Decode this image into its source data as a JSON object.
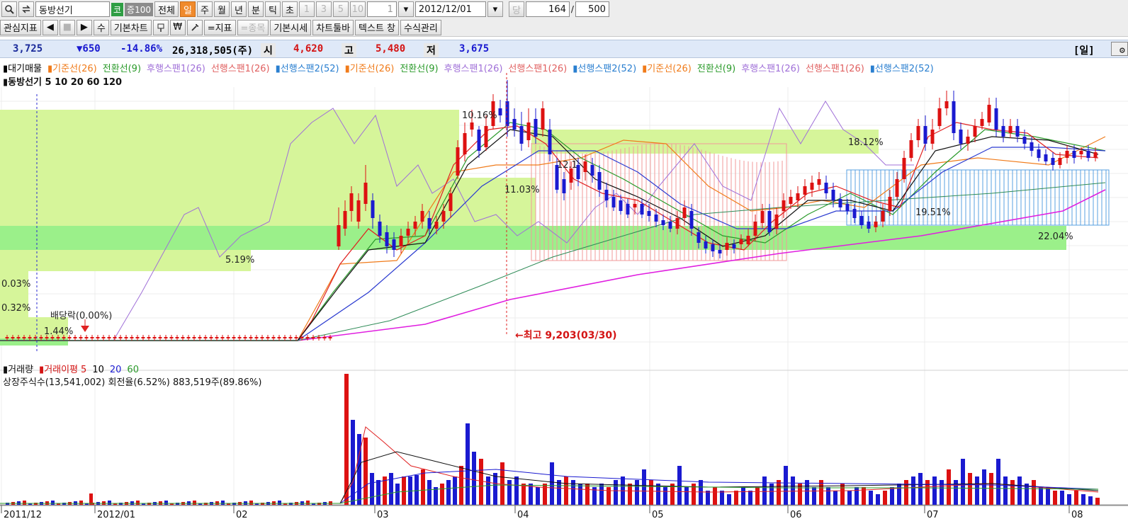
{
  "toolbar1": {
    "search_icon": "magnifier-icon",
    "refresh_icon": "swap-icon",
    "stock_name": "동방선기",
    "badge_market": "코",
    "badge_group": "증100",
    "btn_all": "전체",
    "periods": [
      "일",
      "주",
      "월",
      "년",
      "분",
      "틱",
      "초"
    ],
    "active_period": "일",
    "minute_steps": [
      "1",
      "3",
      "5",
      "10"
    ],
    "interval_value": "1",
    "date_value": "2012/12/01",
    "date_label": "당",
    "count_value": "164",
    "count_sep": "/",
    "count_total": "500"
  },
  "toolbar2": {
    "watchlist": "관심지표",
    "prev": "◀",
    "stop": "■",
    "next": "▶",
    "edit": "수",
    "basic_chart": "기본차트",
    "icon1": "shovel-icon",
    "won": "₩",
    "tool": "wrench-icon",
    "indicator": "=지표",
    "item": "=종목",
    "basic_quote": "기본시세",
    "toolbar": "차트툴바",
    "text_window": "텍스트 창",
    "formula": "수식관리"
  },
  "quote": {
    "price": "3,725",
    "change": "▼650",
    "pct": "-14.86%",
    "volume": "26,318,505(주)",
    "open_label": "시",
    "open": "4,620",
    "high_label": "고",
    "high": "5,480",
    "low_label": "저",
    "low": "3,675",
    "period_tag": "[일]"
  },
  "legend_top": {
    "items": [
      {
        "text": "▮대기매물",
        "color": "#000000"
      },
      {
        "text": "▮기준선(26)",
        "color": "#f07b1a"
      },
      {
        "text": "전환선(9)",
        "color": "#2a9a2a"
      },
      {
        "text": "후행스팬1(26)",
        "color": "#a070d8"
      },
      {
        "text": "선행스팬1(26)",
        "color": "#e06060"
      },
      {
        "text": "▮선행스팬2(52)",
        "color": "#2a7fd0"
      },
      {
        "text": "▮기준선(26)",
        "color": "#f07b1a"
      },
      {
        "text": "전환선(9)",
        "color": "#2a9a2a"
      },
      {
        "text": "후행스팬1(26)",
        "color": "#a070d8"
      },
      {
        "text": "선행스팬1(26)",
        "color": "#e06060"
      },
      {
        "text": "▮선행스팬2(52)",
        "color": "#2a7fd0"
      },
      {
        "text": "▮기준선(26)",
        "color": "#f07b1a"
      },
      {
        "text": "전환선(9)",
        "color": "#2a9a2a"
      },
      {
        "text": "후행스팬1(26)",
        "color": "#a070d8"
      },
      {
        "text": "선행스팬1(26)",
        "color": "#e06060"
      },
      {
        "text": "▮선행스팬2(52)",
        "color": "#2a7fd0"
      }
    ],
    "line2": "▮동방선기 5 10 20 60 120"
  },
  "annotations": {
    "p1": "10.16%",
    "p2": "18.12%",
    "p3": "11.03%",
    "p4": "5.19%",
    "p5": "0.03%",
    "p6": "0.32%",
    "p7": "1.44%",
    "p8": "22.04%",
    "p9": "19.51%",
    "p10": "12.1",
    "dividend": "배당락(0.00%)",
    "max_price": "←최고  9,203(03/30)"
  },
  "legend_vol": {
    "line1_label": "▮거래량",
    "line1_ma": "▮거래이평",
    "ma5": "5",
    "ma10": "10",
    "ma20": "20",
    "ma60": "60",
    "line2": "상장주식수(13,541,002) 회전율(6.52%) 883,519주(89.86%)"
  },
  "xaxis": {
    "labels": [
      "2011/12",
      "2012/01",
      "02",
      "03",
      "04",
      "05",
      "06",
      "07",
      "08"
    ]
  },
  "colors": {
    "up": "#dd1111",
    "down": "#1a1ad0",
    "zone": "#d6f59a",
    "zone_strong": "#9bf08a",
    "ma120": "#e01ee0",
    "lagging": "#a070d8",
    "base": "#f07b1a",
    "conv": "#2a9a2a",
    "span1": "#e06060",
    "span2": "#2a7fd0"
  },
  "chart_data": {
    "type": "candlestick",
    "title": "동방선기",
    "x_axis": "date",
    "ohlc_daily_months": [
      "2011/12",
      "2012/01",
      "02",
      "03",
      "04",
      "05",
      "06",
      "07",
      "08"
    ],
    "series_close_approx": [
      {
        "month": "2011/12",
        "close": 1000
      },
      {
        "month": "2012/01",
        "close": 1050
      },
      {
        "month": "02",
        "close": 1150
      },
      {
        "month": "03",
        "close": 4800
      },
      {
        "month": "04",
        "close": 6900
      },
      {
        "month": "05",
        "close": 4700
      },
      {
        "month": "06",
        "close": 5400
      },
      {
        "month": "07",
        "close": 6700
      },
      {
        "month": "08",
        "close": 6400
      }
    ],
    "max_label": "최고 9,203(03/30)",
    "volume_legend": [
      "5",
      "10",
      "20",
      "60"
    ]
  }
}
